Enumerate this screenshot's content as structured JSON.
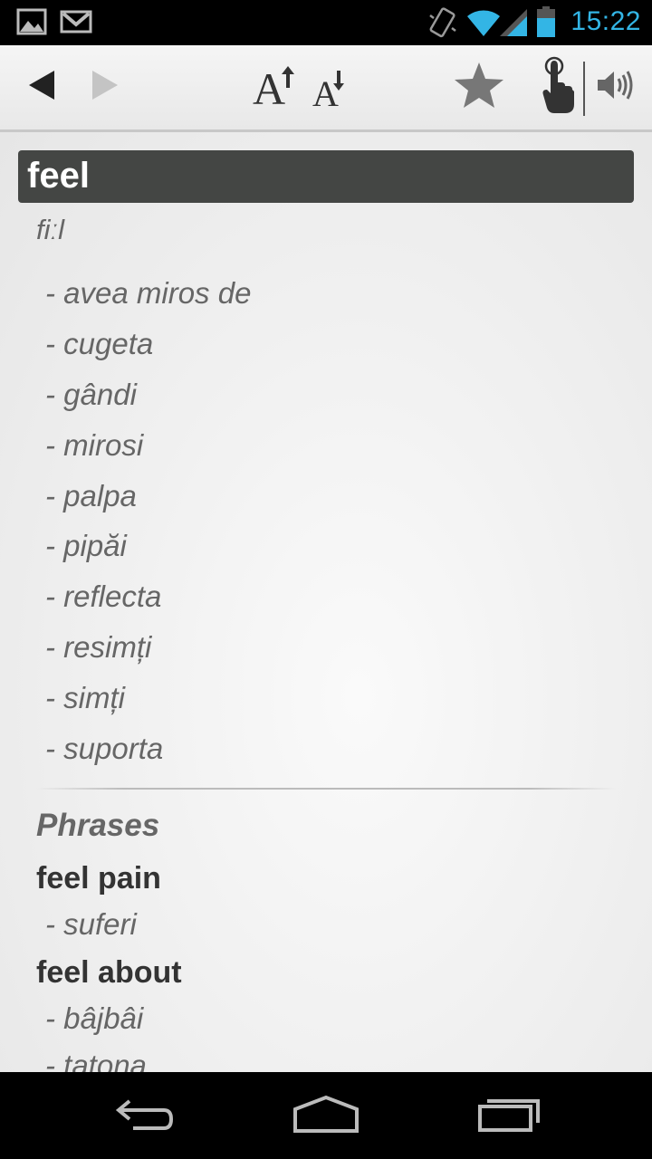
{
  "status_bar": {
    "time": "15:22",
    "icons": [
      "gallery-icon",
      "gmail-icon",
      "vibrate-icon",
      "wifi-icon",
      "signal-icon",
      "battery-icon"
    ],
    "time_color": "#33b5e5"
  },
  "toolbar": {
    "back": "back-arrow-icon",
    "forward": "forward-arrow-icon",
    "font_increase": "A",
    "font_decrease": "A",
    "favorite": "star-icon",
    "touch": "hand-pointer-icon",
    "speaker": "speaker-icon"
  },
  "entry": {
    "headword": "feel",
    "pronunciation": "fiːl",
    "meanings": [
      "- avea miros de",
      "- cugeta",
      "- gândi",
      "- mirosi",
      "- palpa",
      "- pipăi",
      "- reflecta",
      "- resimți",
      "- simți",
      "- suporta"
    ]
  },
  "phrases": {
    "heading": "Phrases",
    "items": [
      {
        "title": "feel pain",
        "meanings": [
          "- suferi"
        ]
      },
      {
        "title": "feel about",
        "meanings": [
          "- bâjbâi",
          "- tatona"
        ]
      }
    ]
  },
  "nav_bar": {
    "back": "nav-back-icon",
    "home": "nav-home-icon",
    "recents": "nav-recents-icon"
  }
}
